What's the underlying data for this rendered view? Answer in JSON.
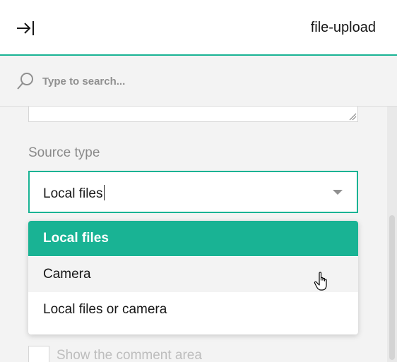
{
  "header": {
    "collapse_icon": "collapse-to-right-icon",
    "title": "file-upload"
  },
  "search": {
    "icon": "search-icon",
    "placeholder": "Type to search..."
  },
  "form": {
    "source_type_label": "Source type",
    "source_type_value": "Local files",
    "hidden_checkbox_label": "Show the comment area"
  },
  "dropdown": {
    "options": [
      {
        "label": "Local files",
        "state": "selected"
      },
      {
        "label": "Camera",
        "state": "hovered"
      },
      {
        "label": "Local files or camera",
        "state": "normal"
      }
    ]
  },
  "colors": {
    "accent": "#19b394",
    "background": "#f3f3f3",
    "text": "#161616",
    "muted_text": "#909090"
  }
}
